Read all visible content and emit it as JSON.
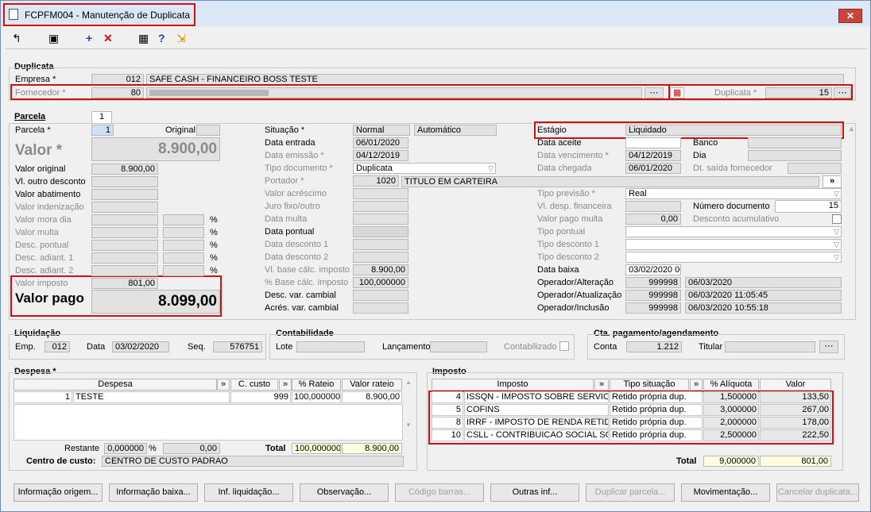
{
  "window": {
    "title": "FCPFM004 - Manutenção de Duplicata",
    "close": "✕"
  },
  "toolbar": {
    "icons": [
      "back-icon",
      "save-icon",
      "add-icon",
      "delete-icon",
      "calculator-icon",
      "help-icon",
      "exit-icon"
    ]
  },
  "duplicata": {
    "section": "Duplicata",
    "empresa_label": "Empresa *",
    "empresa_code": "012",
    "empresa_name": "SAFE CASH - FINANCEIRO BOSS TESTE",
    "fornecedor_label": "Fornecedor *",
    "fornecedor_code": "80",
    "duplicata_label": "Duplicata *",
    "duplicata_value": "15"
  },
  "parcela": {
    "tab": "1",
    "section": "Parcela",
    "parcela_label": "Parcela *",
    "parcela_value": "1",
    "original_label": "Original",
    "valor_label": "Valor *",
    "valor_value": "8.900,00",
    "left_rows": [
      {
        "label": "Valor original",
        "value": "8.900,00",
        "pct": ""
      },
      {
        "label": "Vl. outro desconto",
        "value": "",
        "pct": ""
      },
      {
        "label": "Valor abatimento",
        "value": "",
        "pct": ""
      },
      {
        "label": "Valor indenização",
        "value": "",
        "pct": ""
      },
      {
        "label": "Valor mora dia",
        "value": "",
        "pct": "%"
      },
      {
        "label": "Valor multa",
        "value": "",
        "pct": "%"
      },
      {
        "label": "Desc. pontual",
        "value": "",
        "pct": "%"
      },
      {
        "label": "Desc. adiant. 1",
        "value": "",
        "pct": "%"
      },
      {
        "label": "Desc. adiant. 2",
        "value": "",
        "pct": "%"
      }
    ],
    "valor_imposto_label": "Valor imposto",
    "valor_imposto_value": "801,00",
    "valor_pago_label": "Valor pago",
    "valor_pago_value": "8.099,00",
    "situacao_label": "Situação *",
    "situacao_value": "Normal",
    "situacao_auto": "Automático",
    "mid_rows": [
      {
        "label": "Data entrada",
        "value": "06/01/2020"
      },
      {
        "label": "Data emissão *",
        "value": "04/12/2019"
      },
      {
        "label": "Tipo documento *",
        "value": "Duplicata"
      },
      {
        "label": "Portador *",
        "value": "1020"
      },
      {
        "label": "Valor acréscimo",
        "value": ""
      },
      {
        "label": "Juro fixo/outro",
        "value": ""
      },
      {
        "label": "Data multa",
        "value": ""
      },
      {
        "label": "Data pontual",
        "value": ""
      },
      {
        "label": "Data desconto 1",
        "value": ""
      },
      {
        "label": "Data desconto 2",
        "value": ""
      },
      {
        "label": "Vl. base cálc. imposto",
        "value": "8.900,00"
      },
      {
        "label": "% Base cálc. imposto",
        "value": "100,000000"
      },
      {
        "label": "Desc. var. cambial",
        "value": ""
      },
      {
        "label": "Acrés. var. cambial",
        "value": ""
      }
    ],
    "portador_name": "TITULO EM CARTEIRA",
    "portador_btn": "»",
    "estagio_label": "Estágio",
    "estagio_value": "Liquidado",
    "data_aceite_label": "Data aceite",
    "banco_label": "Banco",
    "data_venc_label": "Data vencimento *",
    "data_venc_value": "04/12/2019",
    "dia_label": "Dia",
    "data_chegada_label": "Data chegada",
    "data_chegada_value": "06/01/2020",
    "dt_saida_label": "Dt. saída fornecedor",
    "tipo_prev_label": "Tipo previsão *",
    "tipo_prev_value": "Real",
    "vl_desp_label": "Vl. desp. financeira",
    "num_doc_label": "Número documento",
    "num_doc_value": "15",
    "valor_pago_multa_label": "Valor pago multa",
    "valor_pago_multa_value": "0,00",
    "desc_acum_label": "Desconto acumulativo",
    "tipo_pontual_label": "Tipo pontual",
    "tipo_desc1_label": "Tipo desconto 1",
    "tipo_desc2_label": "Tipo desconto 2",
    "data_baixa_label": "Data baixa",
    "data_baixa_value": "03/02/2020 00",
    "op_alt_label": "Operador/Alteração",
    "op_alt_code": "999998",
    "op_alt_date": "06/03/2020",
    "op_atu_label": "Operador/Atualização",
    "op_atu_code": "999998",
    "op_atu_date": "06/03/2020 11:05:45",
    "op_inc_label": "Operador/Inclusão",
    "op_inc_code": "999998",
    "op_inc_date": "06/03/2020 10:55:18"
  },
  "liquidacao": {
    "section": "Liquidação",
    "emp_label": "Emp.",
    "emp_value": "012",
    "data_label": "Data",
    "data_value": "03/02/2020",
    "seq_label": "Seq.",
    "seq_value": "576751"
  },
  "contabilidade": {
    "section": "Contabilidade",
    "lote_label": "Lote",
    "lanc_label": "Lançamento",
    "contab_label": "Contabilizado"
  },
  "cta": {
    "section": "Cta. pagamento/agendamento",
    "conta_label": "Conta",
    "conta_value": "1.212",
    "titular_label": "Titular"
  },
  "despesa": {
    "section": "Despesa *",
    "headers": [
      "Despesa",
      "»",
      "C. custo",
      "»",
      "% Rateio",
      "Valor rateio"
    ],
    "rows": [
      {
        "code": "1",
        "name": "TESTE",
        "ccusto": "999",
        "rateio": "100,000000",
        "valor": "8.900,00"
      }
    ],
    "restante_label": "Restante",
    "restante_pct": "0,000000",
    "pct_sign": "%",
    "restante_valor": "0,00",
    "total_label": "Total",
    "total_pct": "100,000000",
    "total_valor": "8.900,00",
    "centro_label": "Centro de custo:",
    "centro_value": "CENTRO DE CUSTO PADRAO"
  },
  "imposto": {
    "section": "Imposto",
    "headers": [
      "Imposto",
      "»",
      "Tipo situação",
      "»",
      "% Alíquota",
      "Valor"
    ],
    "rows": [
      {
        "code": "4",
        "name": "ISSQN - IMPOSTO SOBRE SERVICO D",
        "tipo": "Retido própria dup.",
        "aliq": "1,500000",
        "valor": "133,50"
      },
      {
        "code": "5",
        "name": "COFINS",
        "tipo": "Retido própria dup.",
        "aliq": "3,000000",
        "valor": "267,00"
      },
      {
        "code": "8",
        "name": "IRRF - IMPOSTO DE RENDA RETIDO N",
        "tipo": "Retido própria dup.",
        "aliq": "2,000000",
        "valor": "178,00"
      },
      {
        "code": "10",
        "name": "CSLL - CONTRIBUICAO SOCIAL SOB",
        "tipo": "Retido própria dup.",
        "aliq": "2,500000",
        "valor": "222,50"
      }
    ],
    "total_label": "Total",
    "total_aliq": "9,000000",
    "total_valor": "801,00"
  },
  "buttons": [
    {
      "label": "Informação origem...",
      "enabled": true
    },
    {
      "label": "Informação baixa...",
      "enabled": true
    },
    {
      "label": "Inf. liquidação...",
      "enabled": true
    },
    {
      "label": "Observação...",
      "enabled": true
    },
    {
      "label": "Código barras...",
      "enabled": false
    },
    {
      "label": "Outras inf...",
      "enabled": true
    },
    {
      "label": "Duplicar parcela...",
      "enabled": false
    },
    {
      "label": "Movimentação...",
      "enabled": true
    },
    {
      "label": "Cancelar duplicata...",
      "enabled": false
    }
  ]
}
